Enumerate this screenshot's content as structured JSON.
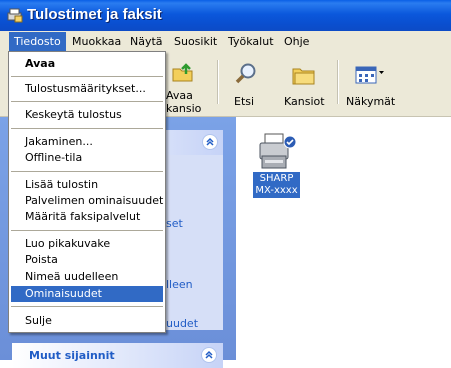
{
  "window": {
    "title": "Tulostimet ja faksit"
  },
  "menubar": {
    "items": [
      "Tiedosto",
      "Muokkaa",
      "Näytä",
      "Suosikit",
      "Työkalut",
      "Ohje"
    ]
  },
  "toolbar": {
    "open_folder_label_1": "Avaa",
    "open_folder_label_2": "kansio",
    "search_label": "Etsi",
    "folders_label": "Kansiot",
    "views_label": "Näkymät"
  },
  "file_menu": {
    "open": "Avaa",
    "printing_prefs": "Tulostusmääritykset...",
    "pause_printing": "Keskeytä tulostus",
    "sharing": "Jakaminen...",
    "offline": "Offline-tila",
    "add_printer": "Lisää tulostin",
    "server_props": "Palvelimen ominaisuudet",
    "fax_services": "Määritä faksipalvelut",
    "create_shortcut": "Luo pikakuvake",
    "delete": "Poista",
    "rename": "Nimeä uudelleen",
    "properties": "Ominaisuudet",
    "close": "Sulje"
  },
  "left_pane": {
    "link_fragments": [
      "set",
      "lleen",
      "uudet"
    ],
    "other_places_title": "Muut sijainnit"
  },
  "printer": {
    "label_line1": "SHARP",
    "label_line2": "MX-xxxx"
  },
  "colors": {
    "titlebar": "#0b58dc",
    "selection": "#316ac5",
    "menu_bg": "#ece9d8",
    "task_pane": "#6b8fd8"
  }
}
